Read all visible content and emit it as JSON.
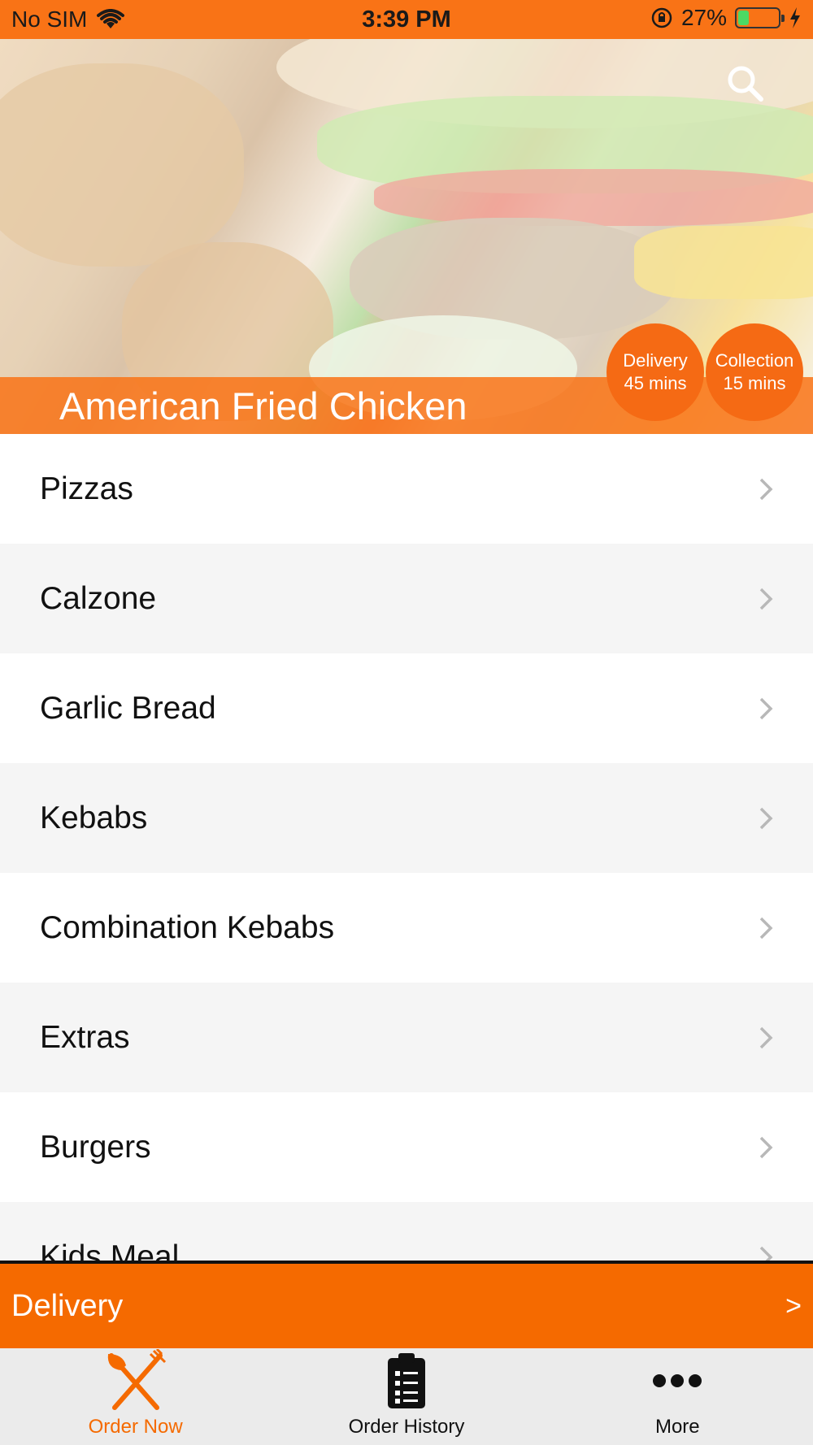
{
  "status_bar": {
    "carrier": "No SIM",
    "time": "3:39 PM",
    "battery_percent": "27%",
    "battery_level": 0.27
  },
  "hero": {
    "restaurant_name": "American Fried Chicken",
    "delivery": {
      "label": "Delivery",
      "time": "45 mins"
    },
    "collection": {
      "label": "Collection",
      "time": "15 mins"
    }
  },
  "menu": {
    "categories": [
      {
        "label": "Pizzas"
      },
      {
        "label": "Calzone"
      },
      {
        "label": "Garlic Bread"
      },
      {
        "label": "Kebabs"
      },
      {
        "label": "Combination Kebabs"
      },
      {
        "label": "Extras"
      },
      {
        "label": "Burgers"
      },
      {
        "label": "Kids Meal"
      }
    ]
  },
  "order_bar": {
    "type": "Delivery",
    "arrow": ">"
  },
  "tabs": [
    {
      "label": "Order Now",
      "icon": "fork-knife-icon",
      "active": true
    },
    {
      "label": "Order History",
      "icon": "clipboard-list-icon",
      "active": false
    },
    {
      "label": "More",
      "icon": "more-dots-icon",
      "active": false
    }
  ],
  "colors": {
    "accent": "#f56a00",
    "status_bar": "#f97316",
    "row_alt": "#f5f5f5",
    "tab_bar": "#ebebeb"
  }
}
